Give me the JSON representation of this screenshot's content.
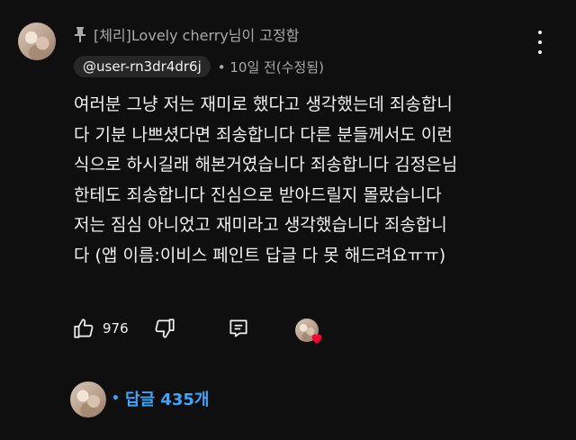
{
  "pinned": {
    "label": "[체리]Lovely cherry님이 고정함"
  },
  "comment": {
    "author_handle": "@user-rn3dr4dr6j",
    "timestamp": "• 10일 전(수정됨)",
    "lines": [
      "여러분 그냥 저는 재미로 했다고 생각했는데 죄송합니",
      "다 기분 나쁘셨다면 죄송합니다 다른 분들께서도 이런",
      "식으로 하시길래 해본거였습니다 죄송합니다 김정은님",
      "한테도 죄송합니다 진심으로 받아드릴지 몰랐습니다",
      "저는  짐심 아니었고 재미라고 생각했습니다 죄송합니",
      "다 (앱 이름:이비스 페인트 답글 다 못 해드려요ㅠㅠ)"
    ]
  },
  "actions": {
    "like_count": "976",
    "like_icon": "thumbs-up-icon",
    "dislike_icon": "thumbs-down-icon",
    "reply_icon": "reply-icon"
  },
  "replies": {
    "dot": "•",
    "label": "답글 435개"
  },
  "colors": {
    "background": "#0f0f0f",
    "link": "#3ea6ff",
    "heart": "#ff0033",
    "muted": "#aaaaaa"
  }
}
